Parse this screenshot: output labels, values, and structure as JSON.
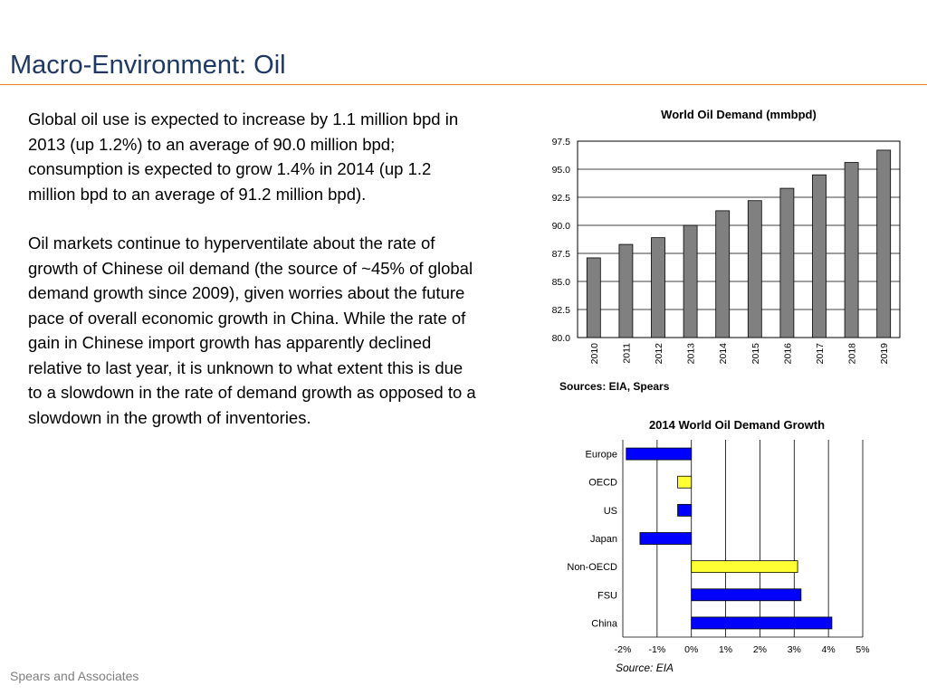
{
  "slide": {
    "title": "Macro-Environment: Oil",
    "paragraphs": [
      "Global oil use is expected to increase by 1.1 million bpd in 2013 (up 1.2%) to an average of 90.0 million bpd; consumption is expected to grow 1.4% in 2014 (up 1.2 million bpd to an average of 91.2 million bpd).",
      "Oil markets continue to hyperventilate about the rate of  growth of Chinese oil demand (the source of ~45% of global demand growth since 2009), given worries about the future pace of overall economic growth in China.  While the rate of gain in Chinese import growth has apparently declined relative to last year, it is unknown to what extent this is due to a slowdown in the rate of demand growth as opposed to a slowdown in the growth of inventories."
    ],
    "footer": "Spears and Associates"
  },
  "colors": {
    "title": "#1f3864",
    "rule": "#ed7d31",
    "bar_gray": "#808080",
    "bar_blue": "#0000ff",
    "bar_yellow": "#ffff33"
  },
  "chart_data": [
    {
      "type": "bar",
      "title": "World Oil Demand (mmbpd)",
      "source": "Sources: EIA, Spears",
      "categories": [
        "2010",
        "2011",
        "2012",
        "2013",
        "2014",
        "2015",
        "2016",
        "2017",
        "2018",
        "2019"
      ],
      "values": [
        87.1,
        88.3,
        88.9,
        90.0,
        91.3,
        92.2,
        93.3,
        94.5,
        95.6,
        96.7
      ],
      "ylim": [
        80.0,
        97.5
      ],
      "yticks": [
        "80.0",
        "82.5",
        "85.0",
        "87.5",
        "90.0",
        "92.5",
        "95.0",
        "97.5"
      ],
      "grid": true,
      "legend": "none"
    },
    {
      "type": "bar",
      "orientation": "horizontal",
      "title": "2014 World Oil Demand Growth",
      "source": "Source: EIA",
      "categories": [
        "Europe",
        "OECD",
        "US",
        "Japan",
        "Non-OECD",
        "FSU",
        "China"
      ],
      "values": [
        -1.9,
        -0.4,
        -0.4,
        -1.5,
        3.1,
        3.2,
        4.1
      ],
      "colors": [
        "blue",
        "yellow",
        "blue",
        "blue",
        "yellow",
        "blue",
        "blue"
      ],
      "xlim": [
        -2,
        5
      ],
      "xticks": [
        "-2%",
        "-1%",
        "0%",
        "1%",
        "2%",
        "3%",
        "4%",
        "5%"
      ],
      "grid": true,
      "legend": "none"
    }
  ]
}
